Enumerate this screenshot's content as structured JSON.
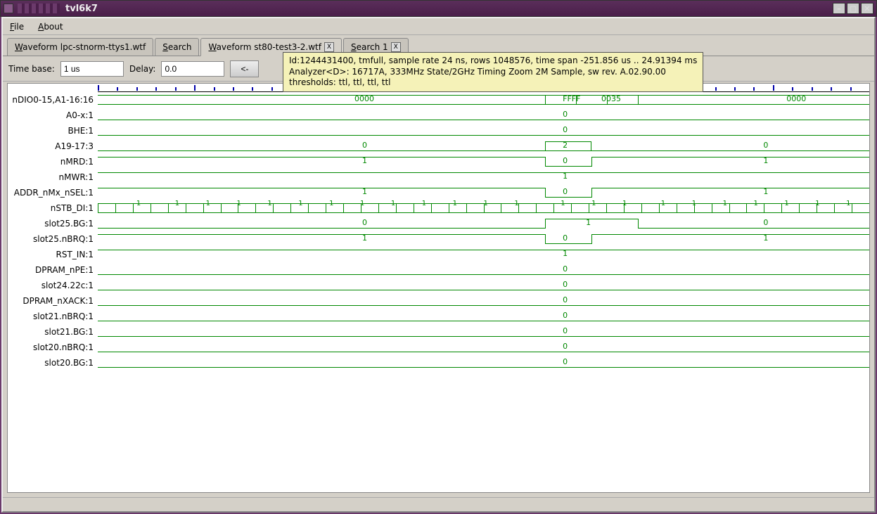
{
  "window": {
    "title": "tvl6k7"
  },
  "menu": {
    "file": "File",
    "about": "About"
  },
  "tabs": [
    {
      "label": "Waveform lpc-stnorm-ttys1.wtf",
      "closable": false
    },
    {
      "label": "Search",
      "closable": false
    },
    {
      "label": "Waveform st80-test3-2.wtf",
      "closable": true,
      "active": true
    },
    {
      "label": "Search 1",
      "closable": true
    }
  ],
  "toolbar": {
    "timebase_label": "Time base:",
    "timebase_value": "1 us",
    "delay_label": "Delay:",
    "delay_value": "0.0",
    "nav_prev": "<-",
    "nav_next": "->"
  },
  "tooltip": {
    "line1": "Id:1244431400, tmfull, sample rate 24 ns, rows 1048576, time span -251.856 us .. 24.91394 ms",
    "line2": "Analyzer<D>: 16717A, 333MHz State/2GHz Timing Zoom 2M Sample, sw rev. A.02.90.00",
    "line3": "thresholds: ttl, ttl, ttl, ttl"
  },
  "signals": [
    {
      "name": "nDIO0-15,A1-16:16",
      "type": "bus",
      "segments": [
        {
          "pos": 34,
          "val": "0000"
        },
        {
          "pos": 61,
          "val": "FFFF",
          "narrow": true
        },
        {
          "pos": 66,
          "val": "0035",
          "narrow": true
        },
        {
          "pos": 90,
          "val": "0000"
        }
      ]
    },
    {
      "name": "A0-x:1",
      "type": "low",
      "val": "0"
    },
    {
      "name": "BHE:1",
      "type": "low",
      "val": "0"
    },
    {
      "name": "A19-17:3",
      "type": "bus-pulse",
      "left_val": "0",
      "mid_val": "2",
      "right_val": "0"
    },
    {
      "name": "nMRD:1",
      "type": "high-dip",
      "left_val": "1",
      "mid_val": "0",
      "right_val": "1"
    },
    {
      "name": "nMWR:1",
      "type": "high",
      "val": "1"
    },
    {
      "name": "ADDR_nMx_nSEL:1",
      "type": "high-dip",
      "left_val": "1",
      "mid_val": "0",
      "right_val": "1"
    },
    {
      "name": "nSTB_DI:1",
      "type": "clock",
      "val": "1"
    },
    {
      "name": "slot25.BG:1",
      "type": "low-pulse",
      "left_val": "0",
      "mid_val": "1",
      "right_val": "0"
    },
    {
      "name": "slot25.nBRQ:1",
      "type": "high-dip-narrow",
      "left_val": "1",
      "mid_val": "0",
      "right_val": "1"
    },
    {
      "name": "RST_IN:1",
      "type": "high",
      "val": "1"
    },
    {
      "name": "DPRAM_nPE:1",
      "type": "low",
      "val": "0"
    },
    {
      "name": "slot24.22c:1",
      "type": "low",
      "val": "0"
    },
    {
      "name": "DPRAM_nXACK:1",
      "type": "low",
      "val": "0"
    },
    {
      "name": "slot21.nBRQ:1",
      "type": "low",
      "val": "0"
    },
    {
      "name": "slot21.BG:1",
      "type": "low",
      "val": "0"
    },
    {
      "name": "slot20.nBRQ:1",
      "type": "low",
      "val": "0"
    },
    {
      "name": "slot20.BG:1",
      "type": "low",
      "val": "0"
    }
  ],
  "cursor_pct": 61.5,
  "pulse": {
    "start_pct": 58,
    "end_pct": 64,
    "wide_end_pct": 70
  }
}
